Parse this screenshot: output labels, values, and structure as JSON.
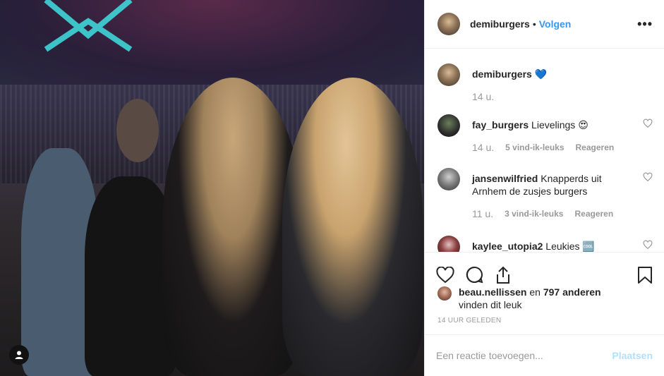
{
  "post": {
    "username": "demiburgers",
    "follow_label": "Volgen",
    "caption_user": "demiburgers",
    "caption_text": "💙",
    "caption_time": "14 u."
  },
  "comments": [
    {
      "user": "fay_burgers",
      "text": "Lievelings 😍",
      "time": "14 u.",
      "likes": "5 vind-ik-leuks",
      "reply": "Reageren",
      "avatar_color": "#2b2b2b"
    },
    {
      "user": "jansenwilfried",
      "text": "Knapperds uit Arnhem de zusjes burgers",
      "time": "11 u.",
      "likes": "3 vind-ik-leuks",
      "reply": "Reageren",
      "avatar_color": "#777777"
    },
    {
      "user": "kaylee_utopia2",
      "text": "Leukies 🆒",
      "time": "",
      "likes": "",
      "reply": "",
      "avatar_color": "#3a2020"
    }
  ],
  "likes": {
    "user": "beau.nellissen",
    "connector": " en ",
    "count": "797 anderen",
    "suffix": "vinden dit leuk"
  },
  "posted_ago": "14 UUR GELEDEN",
  "comment_input": {
    "placeholder": "Een reactie toevoegen...",
    "post_label": "Plaatsen"
  },
  "colors": {
    "accent": "#3897f0",
    "post_disabled": "#b2dffc",
    "muted": "#999999"
  }
}
